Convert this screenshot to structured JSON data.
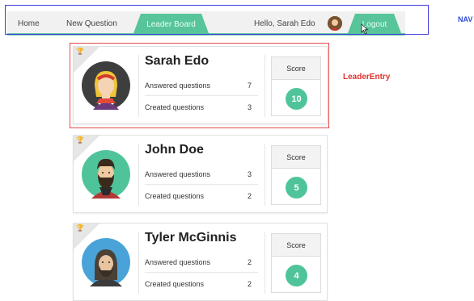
{
  "nav": {
    "home": "Home",
    "new_question": "New Question",
    "leader_board": "Leader Board",
    "greeting": "Hello, Sarah Edo",
    "logout": "Logout",
    "annotation": "NAV",
    "tab_color": "#57c49a"
  },
  "annotation": {
    "leader_entry": "LeaderEntry"
  },
  "score_label": "Score",
  "entries": [
    {
      "name": "Sarah Edo",
      "answered_label": "Answered questions",
      "answered": "7",
      "created_label": "Created questions",
      "created": "3",
      "score": "10",
      "trophy_color": "#e2c83a"
    },
    {
      "name": "John Doe",
      "answered_label": "Answered questions",
      "answered": "3",
      "created_label": "Created questions",
      "created": "2",
      "score": "5",
      "trophy_color": "#4fc49a"
    },
    {
      "name": "Tyler McGinnis",
      "answered_label": "Answered questions",
      "answered": "2",
      "created_label": "Created questions",
      "created": "2",
      "score": "4",
      "trophy_color": "#555555"
    }
  ]
}
